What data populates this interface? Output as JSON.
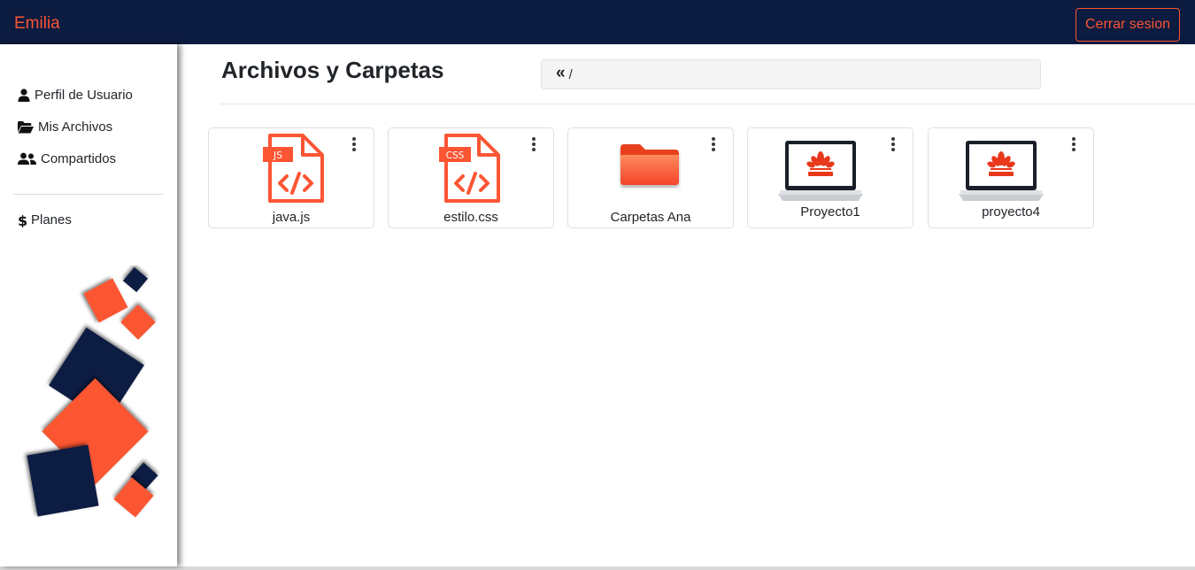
{
  "header": {
    "brand": "Emilia",
    "logout_label": "Cerrar sesion"
  },
  "sidebar": {
    "items": [
      {
        "label": "Perfil de Usuario",
        "icon": "user-icon"
      },
      {
        "label": "Mis Archivos",
        "icon": "folder-open-icon"
      },
      {
        "label": "Compartidos",
        "icon": "users-icon"
      },
      {
        "label": "Planes",
        "icon": "dollar-icon"
      }
    ]
  },
  "main": {
    "title": "Archivos y Carpetas",
    "path": "/",
    "items": [
      {
        "name": "java.js",
        "type": "file",
        "badge": "JS",
        "icon": "js-file-icon"
      },
      {
        "name": "estilo.css",
        "type": "file",
        "badge": "CSS",
        "icon": "css-file-icon"
      },
      {
        "name": "Carpetas Ana",
        "type": "folder",
        "icon": "folder-icon"
      },
      {
        "name": "Proyecto1",
        "type": "project",
        "icon": "laptop-icon"
      },
      {
        "name": "proyecto4",
        "type": "project",
        "icon": "laptop-icon"
      }
    ]
  },
  "colors": {
    "navbar": "#0c1b40",
    "accent": "#fb5533",
    "text": "#212529"
  }
}
